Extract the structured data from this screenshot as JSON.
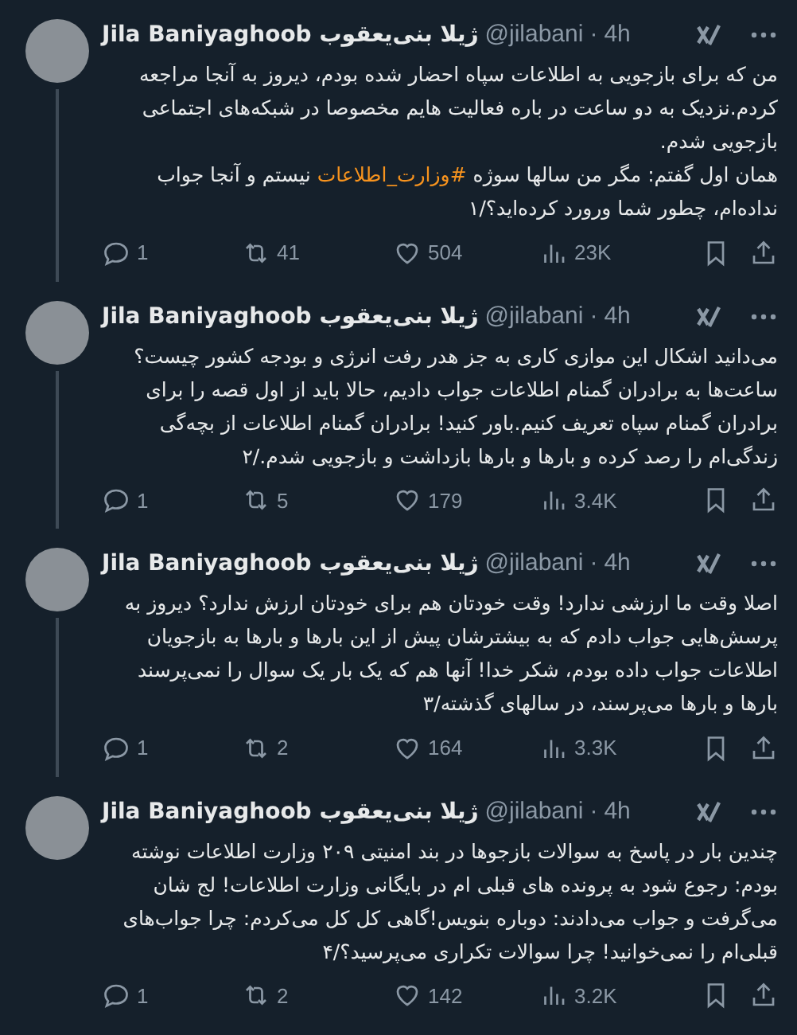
{
  "tweets": [
    {
      "name": "Jila Baniyaghoob ژیلا بنی‌یعقوب",
      "handle": "@jilabani",
      "time": "4h",
      "separator": "·",
      "paragraphs": [
        [
          {
            "kind": "text",
            "text": "من که برای بازجویی به اطلاعات سپاه احضار شده بودم، دیروز به آنجا مراجعه کردم.نزدیک به دو ساعت در باره فعالیت هایم مخصوصا در شبکه‌های اجتماعی بازجویی شدم."
          }
        ],
        [
          {
            "kind": "text",
            "text": "همان اول گفتم: مگر من سالها سوژه "
          },
          {
            "kind": "hashtag",
            "text": "#وزارت_اطلاعات"
          },
          {
            "kind": "text",
            "text": " نیستم و آنجا جواب نداده‌ام، چطور شما ورورد کرده‌اید؟/۱"
          }
        ]
      ],
      "replies": "1",
      "reposts": "41",
      "likes": "504",
      "views": "23K"
    },
    {
      "name": "Jila Baniyaghoob ژیلا بنی‌یعقوب",
      "handle": "@jilabani",
      "time": "4h",
      "separator": "·",
      "paragraphs": [
        [
          {
            "kind": "text",
            "text": "می‌دانید اشکال این موازی کاری به جز هدر رفت انرژی و بودجه کشور چیست؟"
          }
        ],
        [
          {
            "kind": "text",
            "text": "ساعت‌ها به برادران گمنام اطلاعات جواب دادیم، حالا باید از اول قصه را برای برادران گمنام سپاه تعریف کنیم.باور کنید! برادران گمنام اطلاعات از بچه‌گی زندگی‌ام را رصد کرده و بارها و بارها بازداشت و بازجویی شدم./۲"
          }
        ]
      ],
      "replies": "1",
      "reposts": "5",
      "likes": "179",
      "views": "3.4K"
    },
    {
      "name": "Jila Baniyaghoob ژیلا بنی‌یعقوب",
      "handle": "@jilabani",
      "time": "4h",
      "separator": "·",
      "paragraphs": [
        [
          {
            "kind": "text",
            "text": "اصلا وقت ما ارزشی ندارد! وقت خودتان هم برای خودتان ارزش ندارد؟ دیروز به پرسش‌هایی جواب دادم که به بیشترشان پیش از این بارها و بارها به بازجویان اطلاعات جواب داده بودم، شکر خدا! آنها هم که یک بار یک سوال را نمی‌پرسند بارها و بارها می‌پرسند، در سالهای گذشته/۳"
          }
        ]
      ],
      "replies": "1",
      "reposts": "2",
      "likes": "164",
      "views": "3.3K"
    },
    {
      "name": "Jila Baniyaghoob ژیلا بنی‌یعقوب",
      "handle": "@jilabani",
      "time": "4h",
      "separator": "·",
      "paragraphs": [
        [
          {
            "kind": "text",
            "text": "چندین بار در پاسخ به سوالات بازجوها در بند امنیتی ۲۰۹ وزارت اطلاعات نوشته بودم: رجوع شود به پرونده های قبلی ام در بایگانی وزارت اطلاعات! لج شان می‌گرفت و جواب می‌دادند: دوباره بنویس!گاهی کل کل می‌کردم: چرا جواب‌های قبلی‌ام را نمی‌خوانید! چرا سوالات تکراری می‌پرسید؟/۴"
          }
        ]
      ],
      "replies": "1",
      "reposts": "2",
      "likes": "142",
      "views": "3.2K"
    }
  ]
}
